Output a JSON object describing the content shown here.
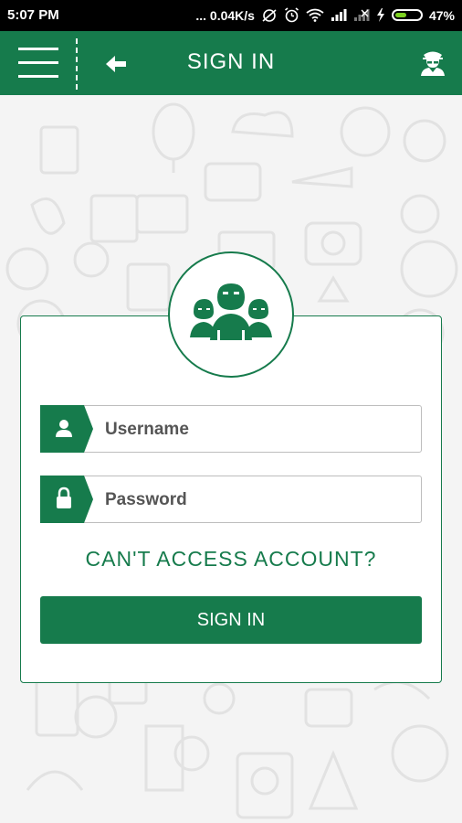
{
  "status_bar": {
    "time": "5:07 PM",
    "network_speed": "... 0.04K/s",
    "battery_percent": "47%",
    "battery_level": 0.47,
    "icons": [
      "sync-off-icon",
      "alarm-icon",
      "wifi-icon",
      "signal-icon",
      "signal-no-sim-icon",
      "charging-icon",
      "battery-icon"
    ]
  },
  "app_bar": {
    "title": "SIGN IN",
    "menu_icon": "hamburger-menu-icon",
    "back_icon": "back-arrow-icon",
    "profile_icon": "agent-profile-icon"
  },
  "form": {
    "avatar_icon": "group-users-icon",
    "username": {
      "placeholder": "Username",
      "value": "",
      "icon": "user-icon"
    },
    "password": {
      "placeholder": "Password",
      "value": "",
      "icon": "lock-icon"
    },
    "cant_access": "CAN'T ACCESS ACCOUNT?",
    "submit_label": "SIGN IN"
  },
  "colors": {
    "primary": "#167b4c",
    "status_bar": "#000000",
    "background": "#f4f4f4",
    "battery_fill": "#7ed321"
  }
}
